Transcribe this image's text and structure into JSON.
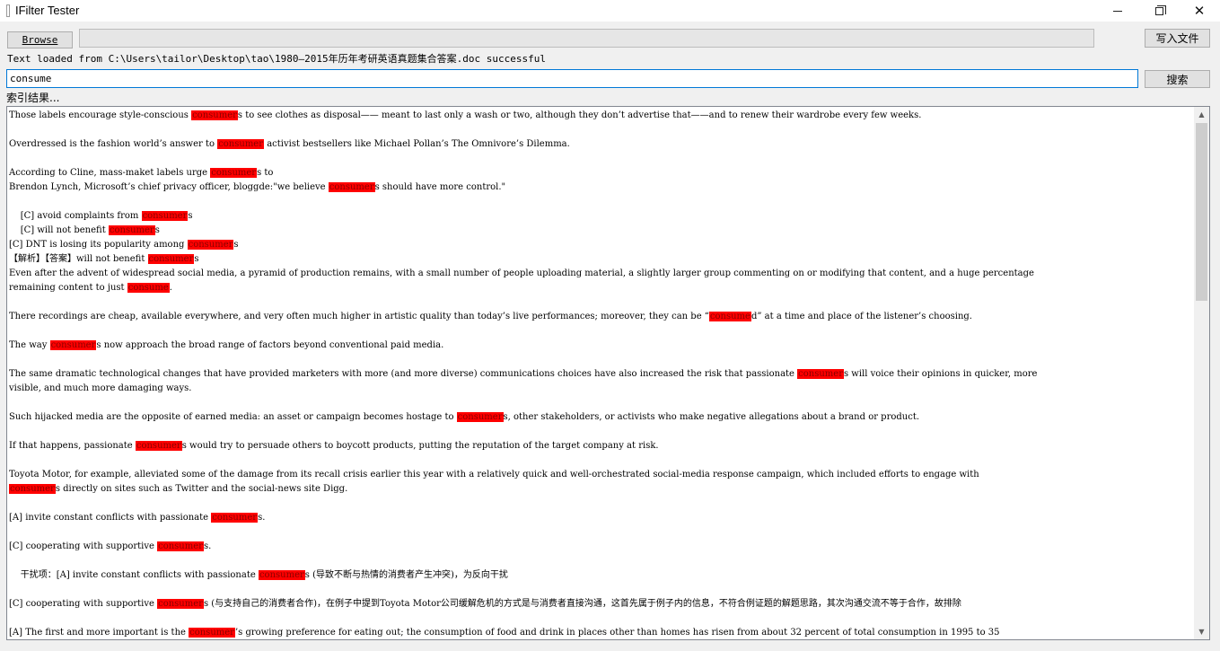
{
  "window": {
    "title": "IFilter Tester",
    "minimize_glyph": "",
    "close_glyph": "✕"
  },
  "toolbar": {
    "browse_label": "Browse",
    "write_file_label": "写入文件",
    "search_label": "搜索"
  },
  "status": {
    "message": "Text loaded from C:\\Users\\tailor\\Desktop\\tao\\1980—2015年历年考研英语真题集合答案.doc successful"
  },
  "search": {
    "value": "consume"
  },
  "results": {
    "label": "索引结果...",
    "lines": [
      {
        "pre": "Those labels encourage style-conscious ",
        "hit": "consumer",
        "post": "s to see clothes as disposal—— meant to last only a wash or two, although they don’t advertise that——and to renew their wardrobe every few weeks."
      },
      {
        "pre": "",
        "hit": "",
        "post": ""
      },
      {
        "pre": "Overdressed is the fashion world’s answer to ",
        "hit": "consumer",
        "post": " activist bestsellers like Michael Pollan’s The Omnivore’s Dilemma."
      },
      {
        "pre": "",
        "hit": "",
        "post": ""
      },
      {
        "pre": "According to Cline, mass-maket labels urge ",
        "hit": "consumer",
        "post": "s to"
      },
      {
        "pre": "Brendon Lynch, Microsoft’s chief privacy officer, bloggde:\"we believe ",
        "hit": "consumer",
        "post": "s should have more control.\""
      },
      {
        "pre": "",
        "hit": "",
        "post": ""
      },
      {
        "pre": "    [C] avoid complaints from ",
        "hit": "consumer",
        "post": "s"
      },
      {
        "pre": "    [C] will not benefit ",
        "hit": "consumer",
        "post": "s"
      },
      {
        "pre": "[C] DNT is losing its popularity among ",
        "hit": "consumer",
        "post": "s"
      },
      {
        "pre": "【解析】【答案】will not benefit ",
        "hit": "consumer",
        "post": "s"
      },
      {
        "pre": "Even after the advent of widespread social media, a pyramid of production remains, with a small number of people uploading material, a slightly larger group commenting on or modifying that content, and a huge percentage",
        "hit": "",
        "post": ""
      },
      {
        "pre": "remaining content to just ",
        "hit": "consume",
        "post": "."
      },
      {
        "pre": "",
        "hit": "",
        "post": ""
      },
      {
        "pre": "There recordings are cheap, available everywhere, and very often much higher in artistic quality than today’s live performances; moreover, they can be “",
        "hit": "consume",
        "post": "d” at a time and place of the listener’s choosing."
      },
      {
        "pre": "",
        "hit": "",
        "post": ""
      },
      {
        "pre": "The way ",
        "hit": "consumer",
        "post": "s now approach the broad range of factors beyond conventional paid media."
      },
      {
        "pre": "",
        "hit": "",
        "post": ""
      },
      {
        "pre": "The same dramatic technological changes that have provided marketers with more (and more diverse) communications choices have also increased the risk that passionate ",
        "hit": "consumer",
        "post": "s will voice their opinions in quicker, more"
      },
      {
        "pre": "visible, and much more damaging ways.",
        "hit": "",
        "post": ""
      },
      {
        "pre": "",
        "hit": "",
        "post": ""
      },
      {
        "pre": "Such hijacked media are the opposite of earned media: an asset or campaign becomes hostage to ",
        "hit": "consumer",
        "post": "s, other stakeholders, or activists who make negative allegations about a brand or product."
      },
      {
        "pre": "",
        "hit": "",
        "post": ""
      },
      {
        "pre": "If that happens, passionate ",
        "hit": "consumer",
        "post": "s would try to persuade others to boycott products, putting the reputation of the target company at risk."
      },
      {
        "pre": "",
        "hit": "",
        "post": ""
      },
      {
        "pre": "Toyota Motor, for example, alleviated some of the damage from its recall crisis earlier this year with a relatively quick and well-orchestrated social-media response campaign, which included efforts to engage with",
        "hit": "",
        "post": ""
      },
      {
        "pre": "",
        "hit": "consumer",
        "post": "s directly on sites such as Twitter and the social-news site Digg."
      },
      {
        "pre": "",
        "hit": "",
        "post": ""
      },
      {
        "pre": "[A] invite constant conflicts with passionate ",
        "hit": "consumer",
        "post": "s."
      },
      {
        "pre": "",
        "hit": "",
        "post": ""
      },
      {
        "pre": "[C] cooperating with supportive ",
        "hit": "consumer",
        "post": "s."
      },
      {
        "pre": "",
        "hit": "",
        "post": ""
      },
      {
        "pre": "    干扰项：[A] invite constant conflicts with passionate ",
        "hit": "consumer",
        "post": "s (导致不断与热情的消费者产生冲突)，为反向干扰"
      },
      {
        "pre": "",
        "hit": "",
        "post": ""
      },
      {
        "pre": "[C] cooperating with supportive ",
        "hit": "consumer",
        "post": "s (与支持自己的消费者合作)，在例子中提到Toyota Motor公司缓解危机的方式是与消费者直接沟通，这首先属于例子内的信息，不符合例证题的解题思路，其次沟通交流不等于合作，故排除"
      },
      {
        "pre": "",
        "hit": "",
        "post": ""
      },
      {
        "pre": "[A] The first and more important is the ",
        "hit": "consumer",
        "post": "’s growing preference for eating out; the consumption of food and drink in places other than homes has risen from about 32 percent of total consumption in 1995 to 35"
      }
    ]
  },
  "scrollbar": {
    "up_glyph": "▲",
    "down_glyph": "▼"
  }
}
